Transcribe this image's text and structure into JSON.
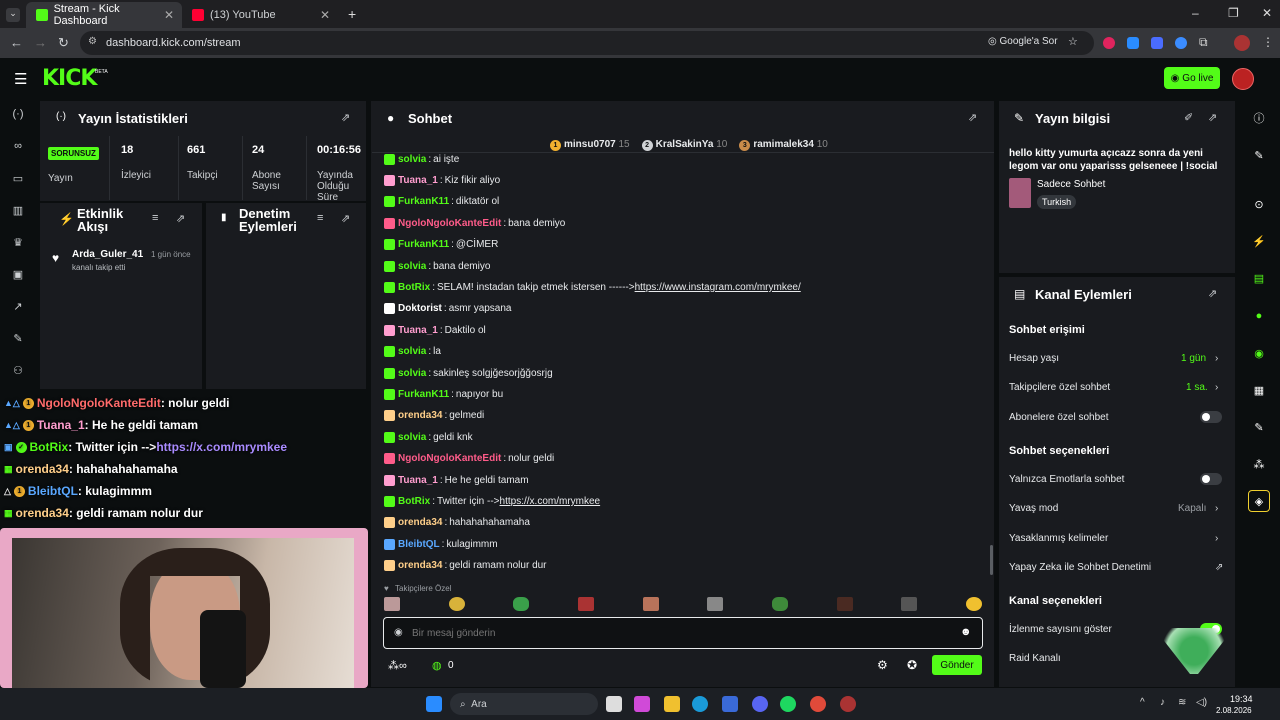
{
  "browser": {
    "tabs": [
      {
        "title": "Stream - Kick Dashboard",
        "color": "#53fc18"
      },
      {
        "title": "(13) YouTube",
        "color": "#ff0033"
      }
    ],
    "url": "dashboard.kick.com/stream",
    "ask_google": "Google'a Sor"
  },
  "header": {
    "logo": "KICK",
    "beta": "BETA",
    "go_live": "Go live"
  },
  "stats": {
    "title": "Yayın İstatistikleri",
    "status": "SORUNSUZ",
    "status_label": "Yayın",
    "items": [
      {
        "value": "18",
        "label": "İzleyici"
      },
      {
        "value": "661",
        "label": "Takipçi"
      },
      {
        "value": "24",
        "label": "Abone Sayısı"
      },
      {
        "value": "00:16:56",
        "label": "Yayında Olduğu Süre"
      }
    ]
  },
  "activity": {
    "title": "Etkinlik Akışı",
    "item": {
      "user": "Arda_Guler_41",
      "text": "kanalı takip etti",
      "time": "1 gün önce"
    }
  },
  "moderation": {
    "title": "Denetim Eylemleri"
  },
  "overlay": [
    {
      "user": "NgoloNgoloKanteEdit",
      "color": "#ff6b6b",
      "text": ": nolur geldi"
    },
    {
      "user": "Tuana_1",
      "color": "#ff9ecf",
      "text": ": He he geldi tamam"
    },
    {
      "user": "BotRix",
      "color": "#53fc18",
      "text": ": Twitter için --> ",
      "link": "https://x.com/mrymkee"
    },
    {
      "user": "orenda34",
      "color": "#ffcf8a",
      "text": ": hahahahahamaha"
    },
    {
      "user": "BleibtQL",
      "color": "#5aa8ff",
      "text": ": kulagimmm"
    },
    {
      "user": "orenda34",
      "color": "#ffcf8a",
      "text": ": geldi ramam nolur dur"
    }
  ],
  "chat": {
    "title": "Sohbet",
    "top": [
      {
        "name": "minsu0707",
        "count": "15"
      },
      {
        "name": "KralSakinYa",
        "count": "10"
      },
      {
        "name": "ramimalek34",
        "count": "10"
      }
    ],
    "messages": [
      {
        "user": "solvia",
        "color": "#53fc18",
        "text": "ai işte"
      },
      {
        "user": "Tuana_1",
        "color": "#ff9ecf",
        "text": "Kiz fikir aliyo"
      },
      {
        "user": "FurkanK11",
        "color": "#53fc18",
        "text": "diktatör ol"
      },
      {
        "user": "NgoloNgoloKanteEdit",
        "color": "#ff5c8a",
        "text": "bana demiyo"
      },
      {
        "user": "FurkanK11",
        "color": "#53fc18",
        "text": "@CİMER"
      },
      {
        "user": "solvia",
        "color": "#53fc18",
        "text": "bana demiyo"
      },
      {
        "user": "BotRix",
        "color": "#53fc18",
        "text": "SELAM! instadan takip etmek istersen ------> ",
        "link": "https://www.instagram.com/mrymkee/"
      },
      {
        "user": "Doktorist",
        "color": "#ffffff",
        "text": "asmr yapsana"
      },
      {
        "user": "Tuana_1",
        "color": "#ff9ecf",
        "text": "Daktilo ol"
      },
      {
        "user": "solvia",
        "color": "#53fc18",
        "text": "la"
      },
      {
        "user": "solvia",
        "color": "#53fc18",
        "text": "sakinleş solgjğesorjğğosrjg"
      },
      {
        "user": "FurkanK11",
        "color": "#53fc18",
        "text": "napıyor bu"
      },
      {
        "user": "orenda34",
        "color": "#ffcf8a",
        "text": "gelmedi"
      },
      {
        "user": "solvia",
        "color": "#53fc18",
        "text": "geldi knk"
      },
      {
        "user": "NgoloNgoloKanteEdit",
        "color": "#ff5c8a",
        "text": "nolur geldi"
      },
      {
        "user": "Tuana_1",
        "color": "#ff9ecf",
        "text": "He he geldi tamam"
      },
      {
        "user": "BotRix",
        "color": "#53fc18",
        "text": "Twitter için --> ",
        "link": "https://x.com/mrymkee"
      },
      {
        "user": "orenda34",
        "color": "#ffcf8a",
        "text": "hahahahahamaha"
      },
      {
        "user": "BleibtQL",
        "color": "#5aa8ff",
        "text": "kulagimmm"
      },
      {
        "user": "orenda34",
        "color": "#ffcf8a",
        "text": "geldi ramam nolur dur"
      }
    ],
    "followers_only": "Takipçilere Özel",
    "placeholder": "Bir mesaj gönderin",
    "send": "Gönder",
    "points": "0"
  },
  "stream_info": {
    "title": "Yayın bilgisi",
    "text": "hello kitty yumurta açıcazz sonra da yeni legom var onu yaparisss gelseneee | !social",
    "category": "Sadece Sohbet",
    "language": "Turkish"
  },
  "channel": {
    "title": "Kanal Eylemleri",
    "chat_access": "Sohbet erişimi",
    "account_age": "Hesap yaşı",
    "account_age_val": "1 gün",
    "followers_chat": "Takipçilere özel sohbet",
    "followers_chat_val": "1 sa.",
    "subs_chat": "Abonelere özel sohbet",
    "chat_options": "Sohbet seçenekleri",
    "emote_only": "Yalnızca Emotlarla sohbet",
    "slow_mode": "Yavaş mod",
    "slow_mode_val": "Kapalı",
    "banned_words": "Yasaklanmış kelimeler",
    "ai_mod": "Yapay Zeka ile Sohbet Denetimi",
    "channel_options": "Kanal seçenekleri",
    "show_views": "İzlenme sayısını göster",
    "raid": "Raid Kanalı"
  },
  "taskbar": {
    "search": "Ara",
    "time": "19:34",
    "date": "2.08.2026"
  }
}
